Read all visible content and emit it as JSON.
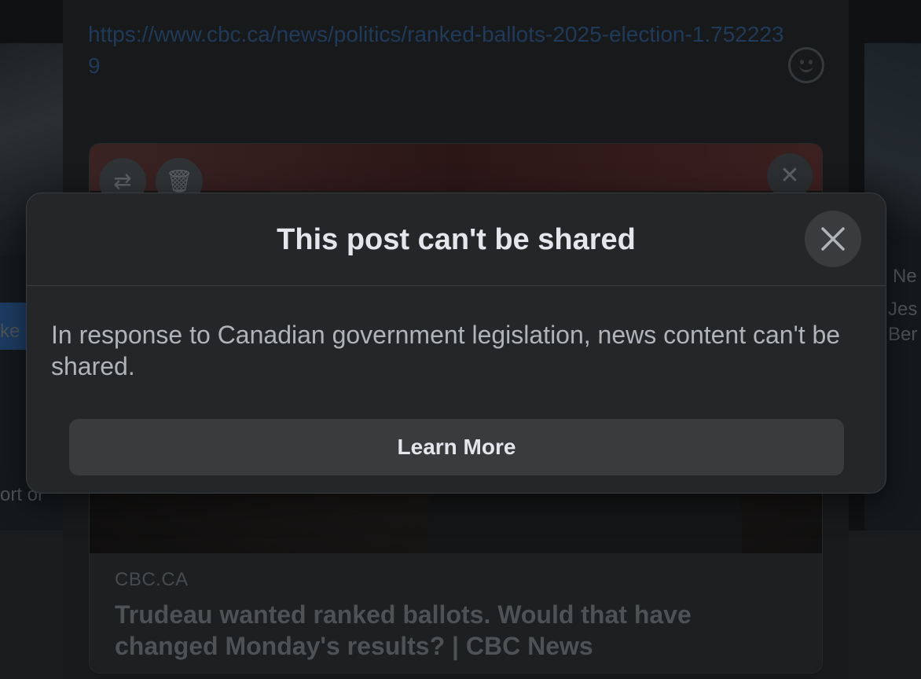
{
  "background": {
    "url_text": "https://www.cbc.ca/news/politics/ranked-ballots-2025-election-1.7522239",
    "link_card": {
      "domain": "CBC.CA",
      "title": "Trudeau wanted ranked ballots. Would that have changed Monday's results? | CBC News"
    },
    "side_right_texts": [
      "Ne",
      "Jes",
      "Ber"
    ],
    "side_left_texts": [
      "ke s",
      "ort or"
    ],
    "icons": [
      "swap-icon",
      "trash-icon",
      "close-icon",
      "emoji-icon"
    ]
  },
  "modal": {
    "title": "This post can't be shared",
    "body": "In response to Canadian government legislation, news content can't be shared.",
    "learn_more_label": "Learn More",
    "close_icon": "close-icon"
  },
  "colors": {
    "modal_bg": "#242628",
    "button_bg": "#3a3b3c",
    "title_text": "#e4e6eb",
    "body_text": "#b0b3b8"
  }
}
